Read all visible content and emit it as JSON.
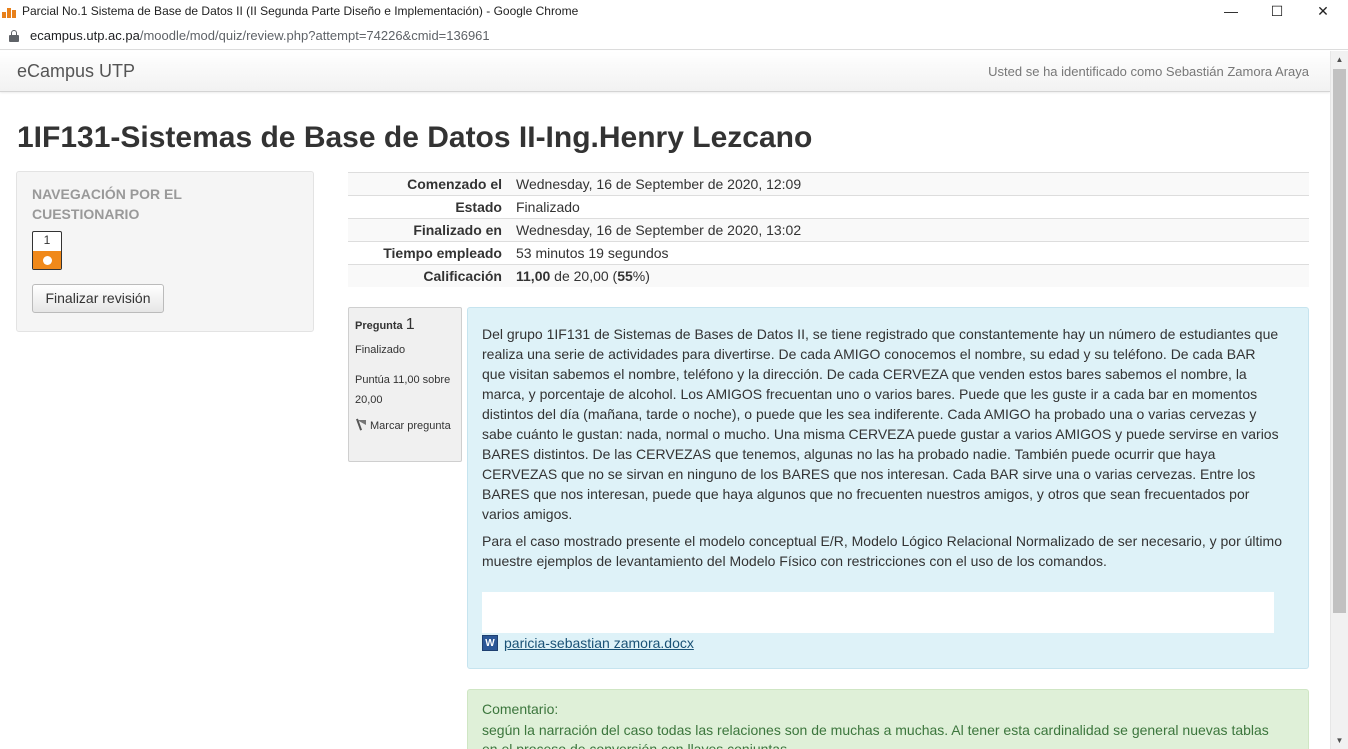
{
  "window": {
    "title": "Parcial No.1 Sistema de Base de Datos II (II Segunda Parte Diseño e Implementación) - Google Chrome",
    "minimize": "—",
    "maximize": "☐",
    "close": "✕"
  },
  "address_bar": {
    "host": "ecampus.utp.ac.pa",
    "path": "/moodle/mod/quiz/review.php?attempt=74226&cmid=136961"
  },
  "header": {
    "brand": "eCampus UTP",
    "login_info": "Usted se ha identificado como Sebastián Zamora Araya"
  },
  "course_title": "1IF131-Sistemas de Base de Datos II-Ing.Henry Lezcano",
  "quiz_nav": {
    "heading": "NAVEGACIÓN POR EL CUESTIONARIO",
    "question_button": "1",
    "finish_review": "Finalizar revisión"
  },
  "summary": [
    {
      "label": "Comenzado el",
      "value": "Wednesday, 16 de September de 2020, 12:09"
    },
    {
      "label": "Estado",
      "value": "Finalizado"
    },
    {
      "label": "Finalizado en",
      "value": "Wednesday, 16 de September de 2020, 13:02"
    },
    {
      "label": "Tiempo empleado",
      "value": "53 minutos 19 segundos"
    }
  ],
  "grade": {
    "label": "Calificación",
    "score": "11,00",
    "of": " de 20,00 (",
    "percent": "55",
    "suffix": "%)"
  },
  "question": {
    "label": "Pregunta",
    "number": "1",
    "state": "Finalizado",
    "grade": "Puntúa 11,00 sobre 20,00",
    "flag": "Marcar pregunta",
    "paragraph1": "Del grupo 1IF131 de  Sistemas de Bases de Datos II, se tiene registrado que constantemente hay un número de estudiantes que realiza una serie de actividades para divertirse. De cada AMIGO conocemos el nombre, su edad y su teléfono. De cada BAR que visitan sabemos el nombre, teléfono y la dirección. De cada CERVEZA que venden estos bares sabemos el nombre, la marca, y porcentaje de alcohol. Los AMIGOS frecuentan uno o varios bares. Puede que les guste ir a cada bar en momentos distintos del día (mañana, tarde o noche), o puede que les sea indiferente. Cada AMIGO ha probado una o varias cervezas y sabe cuánto le gustan: nada, normal o mucho. Una misma CERVEZA puede gustar a varios AMIGOS y puede servirse en varios BARES distintos. De las CERVEZAS que tenemos, algunas no las ha probado nadie. También puede ocurrir que haya CERVEZAS que no se sirvan en ninguno de los BARES que nos interesan. Cada BAR sirve una o varias cervezas. Entre los BARES que nos interesan, puede que haya algunos que no frecuenten nuestros amigos, y otros que sean frecuentados por varios amigos.",
    "paragraph2": "Para el caso mostrado presente el modelo conceptual E/R, Modelo Lógico Relacional Normalizado de ser necesario, y por último muestre  ejemplos de levantamiento del Modelo Físico con  restricciones con el uso de los comandos.",
    "attachment_icon": "W",
    "attachment": " paricia-sebastian zamora.docx"
  },
  "comment": {
    "label": "Comentario:",
    "text": "según la narración del caso todas las relaciones son de muchas a muchas. Al tener esta cardinalidad se general nuevas tablas en el proceso de conversión con llaves conjuntas."
  },
  "colors": {
    "info_bg": "#def2f8",
    "comment_bg": "#dff0d8",
    "answered_state": "#f0891a"
  }
}
